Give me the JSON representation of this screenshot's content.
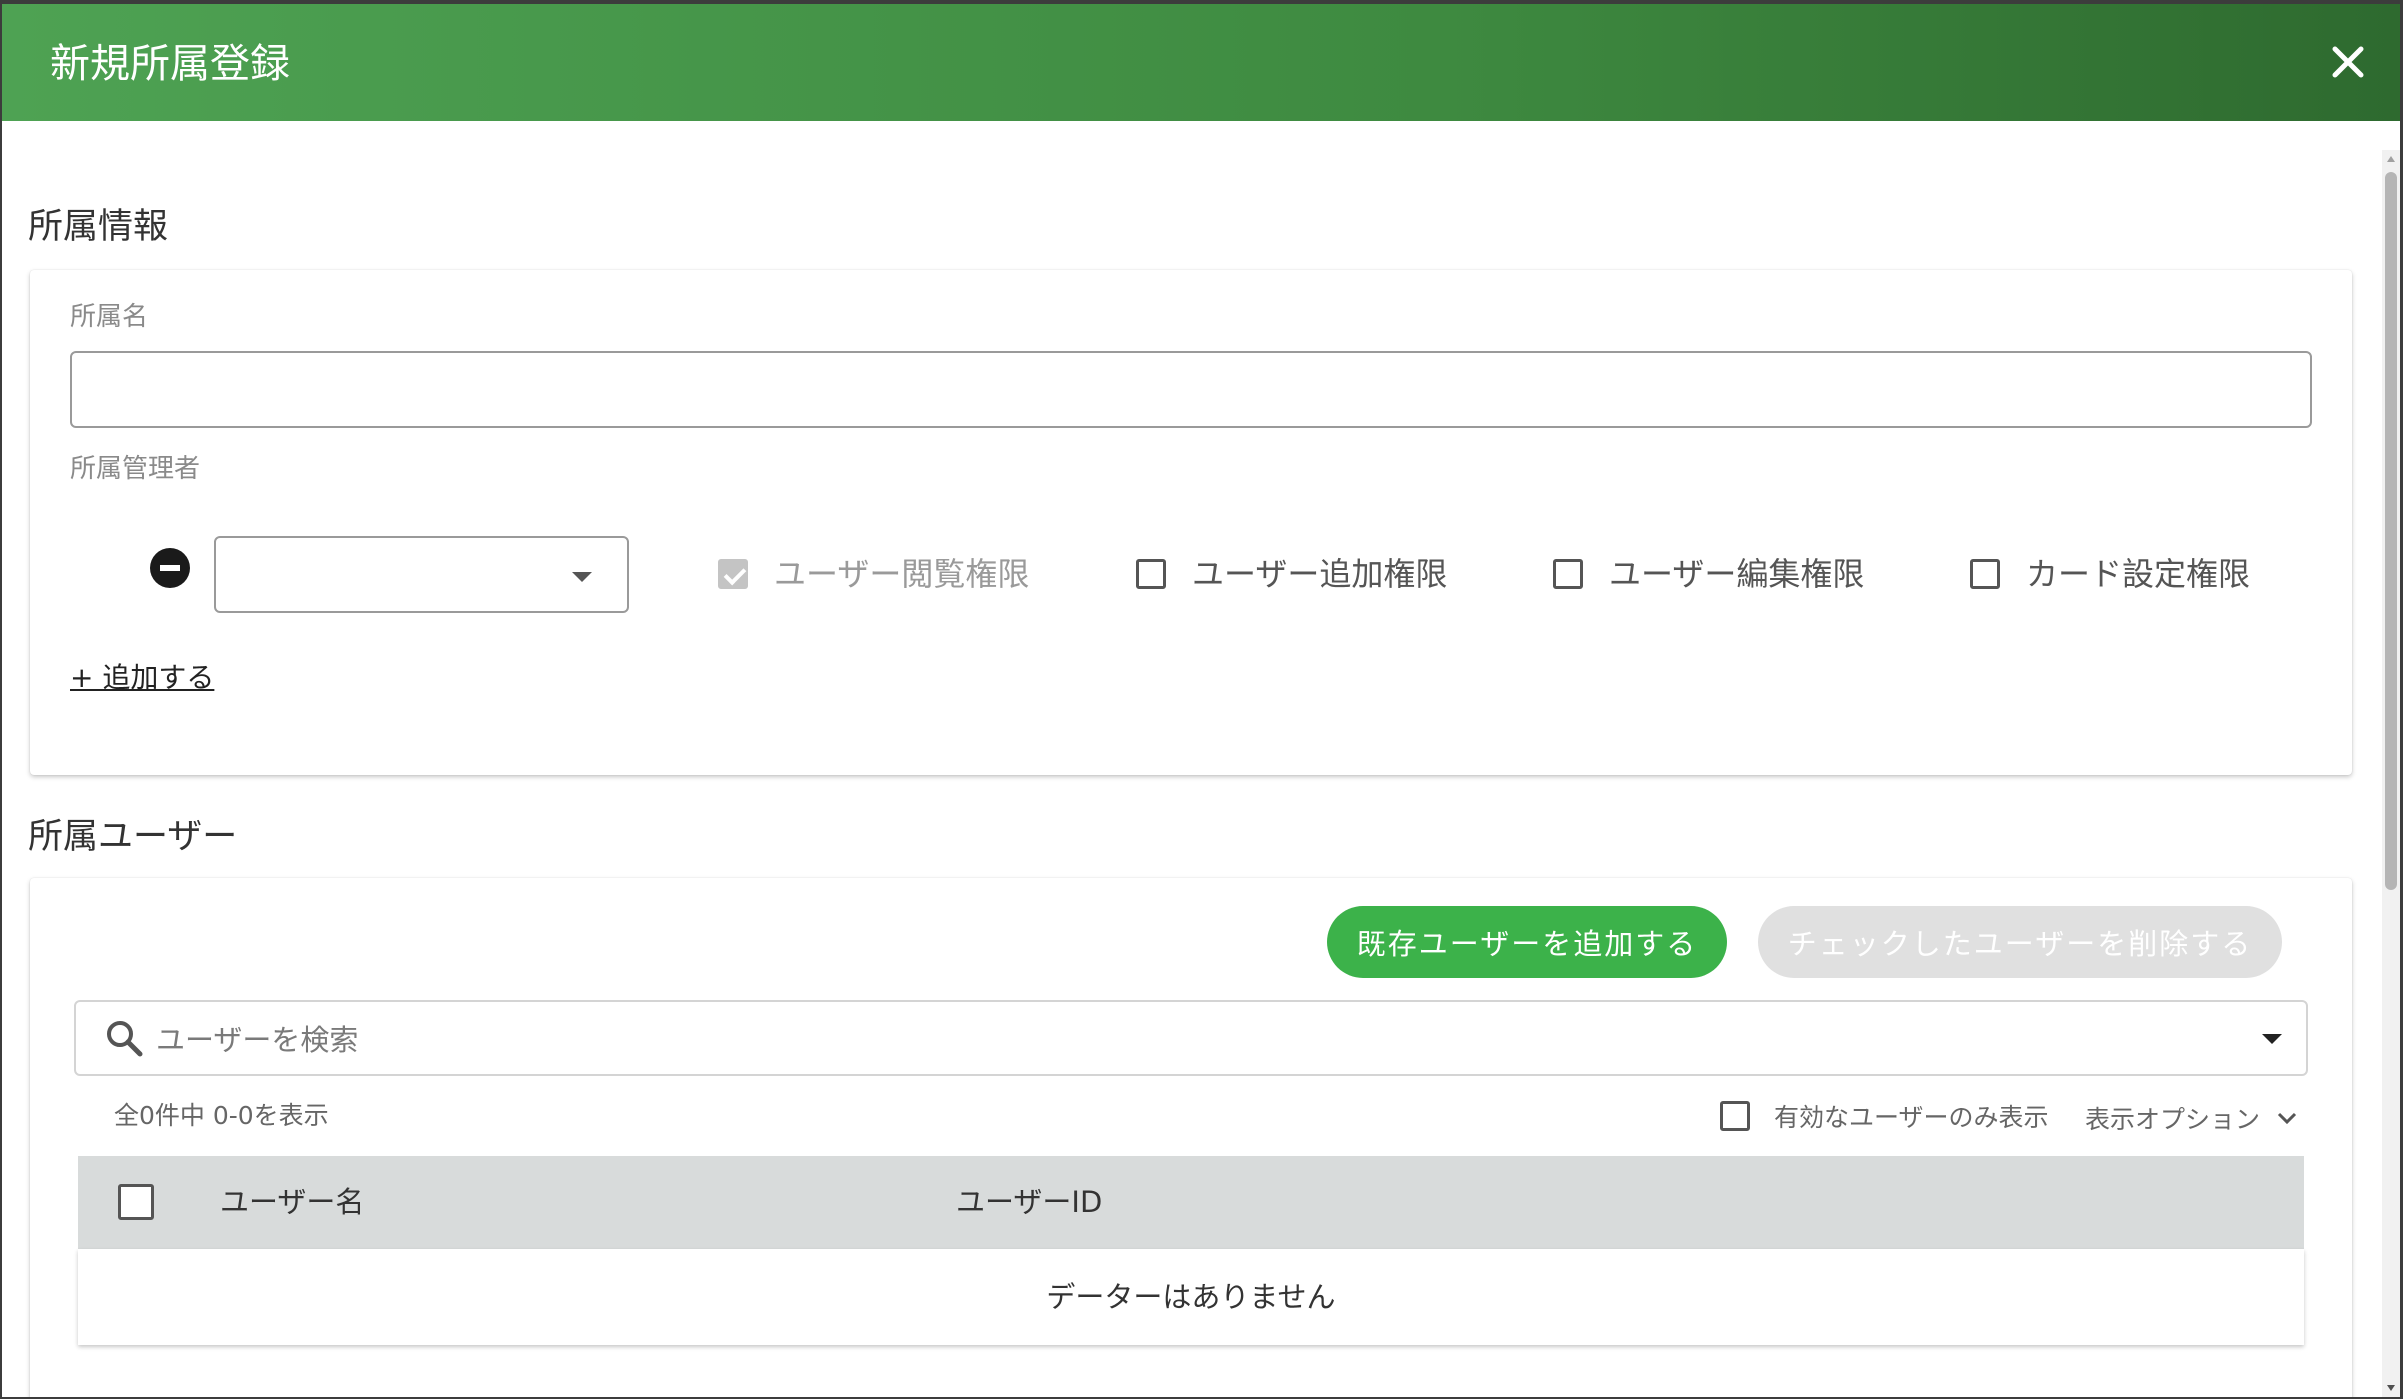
{
  "dialog": {
    "title": "新規所属登録",
    "accent_color": "#4ea253",
    "close_icon": "close-icon"
  },
  "info_section": {
    "title": "所属情報",
    "name_label": "所属名",
    "name_value": "",
    "manager_label": "所属管理者",
    "manager_select_value": "",
    "permissions": [
      {
        "label": "ユーザー閲覧権限",
        "checked": true,
        "disabled": true
      },
      {
        "label": "ユーザー追加権限",
        "checked": false,
        "disabled": false
      },
      {
        "label": "ユーザー編集権限",
        "checked": false,
        "disabled": false
      },
      {
        "label": "カード設定権限",
        "checked": false,
        "disabled": false
      }
    ],
    "add_link": "+ 追加する"
  },
  "users_section": {
    "title": "所属ユーザー",
    "add_existing_button": "既存ユーザーを追加する",
    "delete_checked_button": "チェックしたユーザーを削除する",
    "search_placeholder": "ユーザーを検索",
    "count_text": "全0件中 0-0を表示",
    "active_only_label": "有効なユーザーのみ表示",
    "display_options_label": "表示オプション",
    "table": {
      "columns": [
        "ユーザー名",
        "ユーザーID"
      ],
      "empty_message": "データーはありません"
    }
  },
  "colors": {
    "primary_button": "#3cb24a",
    "disabled_button": "#e0e0e0",
    "table_header_bg": "#d8dbdb"
  }
}
